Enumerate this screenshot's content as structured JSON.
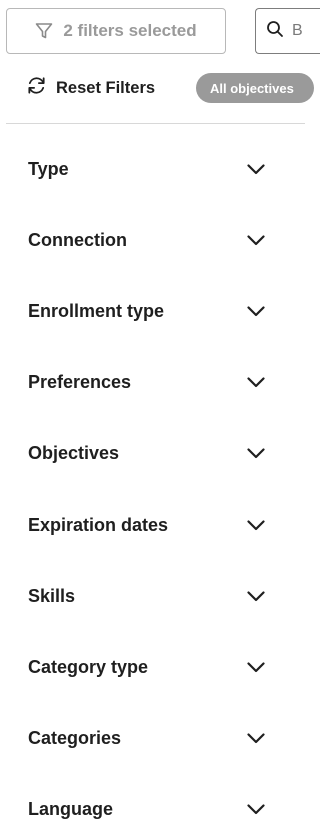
{
  "toolbar": {
    "filters_label": "2 filters selected",
    "search_placeholder": "B",
    "reset_label": "Reset Filters",
    "objectives_pill": "All objectives"
  },
  "facets": [
    {
      "label": "Type"
    },
    {
      "label": "Connection"
    },
    {
      "label": "Enrollment type"
    },
    {
      "label": "Preferences"
    },
    {
      "label": "Objectives"
    },
    {
      "label": "Expiration dates"
    },
    {
      "label": "Skills"
    },
    {
      "label": "Category type"
    },
    {
      "label": "Categories"
    },
    {
      "label": "Language"
    }
  ],
  "colors": {
    "text": "#1f1f1f",
    "muted": "#9a9a9a",
    "pill_bg": "#9a9a9a",
    "border": "#b8b8b8"
  },
  "icons": [
    "filter-funnel-icon",
    "search-icon",
    "reset-icon",
    "chevron-down-icon"
  ]
}
